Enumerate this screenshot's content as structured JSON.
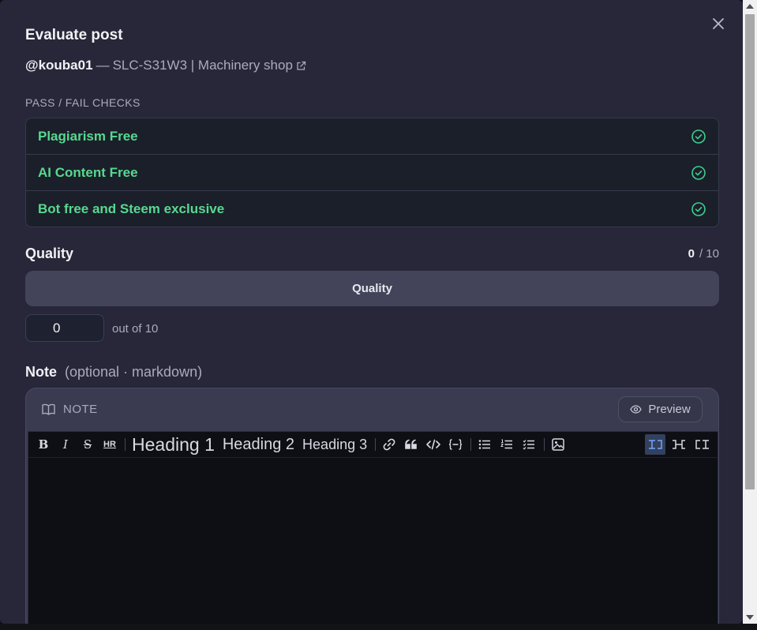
{
  "modal": {
    "title": "Evaluate post",
    "author": "@kouba01",
    "dash": "—",
    "post_title": "SLC-S31W3 | Machinery shop",
    "close_icon": "close-icon",
    "external_icon": "external-link-icon"
  },
  "checks": {
    "section_label": "PASS / FAIL CHECKS",
    "items": [
      {
        "label": "Plagiarism Free",
        "status": "pass",
        "icon": "check-circle-icon"
      },
      {
        "label": "AI Content Free",
        "status": "pass",
        "icon": "check-circle-icon"
      },
      {
        "label": "Bot free and Steem exclusive",
        "status": "pass",
        "icon": "check-circle-icon"
      }
    ],
    "pass_color": "#57d98f"
  },
  "quality": {
    "title": "Quality",
    "score_value": "0",
    "score_max": "/ 10",
    "bar_label": "Quality",
    "input_value": "0",
    "out_of_text": "out of 10"
  },
  "note": {
    "title": "Note",
    "hint": "(optional · markdown)",
    "card_label": "NOTE",
    "card_icon": "book-open-icon",
    "preview_label": "Preview",
    "preview_icon": "eye-icon",
    "toolbar": {
      "bold": "B",
      "italic": "I",
      "strike": "S",
      "hr": "HR",
      "heading1": "Heading 1",
      "heading2": "Heading 2",
      "heading3": "Heading 3",
      "link_icon": "link-icon",
      "quote_icon": "quote-icon",
      "code_icon": "code-icon",
      "codeblock_icon": "code-block-icon",
      "ul_icon": "unordered-list-icon",
      "ol_icon": "ordered-list-icon",
      "tasklist_icon": "checklist-icon",
      "image_icon": "image-icon",
      "view_edit_icon": "edit-mode-icon",
      "view_split_icon": "split-mode-icon",
      "view_preview_icon": "preview-mode-icon"
    },
    "active_view": "edit"
  }
}
